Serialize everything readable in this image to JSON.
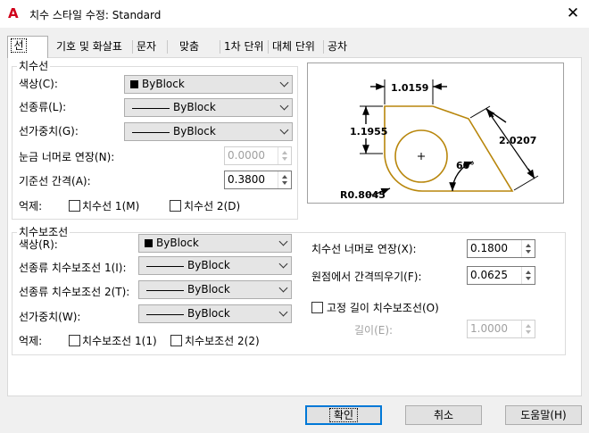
{
  "window": {
    "title": "치수 스타일 수정: Standard",
    "icon": "autocad-a-icon",
    "close_glyph": "✕"
  },
  "tabs": [
    {
      "label": "선",
      "active": true
    },
    {
      "label": "기호 및 화살표"
    },
    {
      "label": "문자"
    },
    {
      "label": "맞춤"
    },
    {
      "label": "1차 단위"
    },
    {
      "label": "대체 단위"
    },
    {
      "label": "공차"
    }
  ],
  "dimension_lines": {
    "group_label": "치수선",
    "color_label": "색상(C):",
    "color_value": "ByBlock",
    "linetype_label": "선종류(L):",
    "linetype_value": "ByBlock",
    "lineweight_label": "선가중치(G):",
    "lineweight_value": "ByBlock",
    "extend_ticks_label": "눈금 너머로 연장(N):",
    "extend_ticks_value": "0.0000",
    "baseline_spacing_label": "기준선 간격(A):",
    "baseline_spacing_value": "0.3800",
    "suppress_label": "억제:",
    "suppress_1": "치수선 1(M)",
    "suppress_2": "치수선 2(D)"
  },
  "extension_lines": {
    "group_label": "치수보조선",
    "color_label": "색상(R):",
    "color_value": "ByBlock",
    "linetype1_label": "선종류 치수보조선 1(I):",
    "linetype1_value": "ByBlock",
    "linetype2_label": "선종류 치수보조선 2(T):",
    "linetype2_value": "ByBlock",
    "lineweight_label": "선가중치(W):",
    "lineweight_value": "ByBlock",
    "suppress_label": "억제:",
    "suppress_1": "치수보조선 1(1)",
    "suppress_2": "치수보조선 2(2)",
    "extend_beyond_label": "치수선 너머로 연장(X):",
    "extend_beyond_value": "0.1800",
    "offset_label": "원점에서 간격띄우기(F):",
    "offset_value": "0.0625",
    "fixed_length_label": "고정 길이 치수보조선(O)",
    "length_label": "길이(E):",
    "length_value": "1.0000"
  },
  "preview": {
    "dim_top": "1.0159",
    "dim_left": "1.1955",
    "dim_right": "2.0207",
    "dim_angle": "60°",
    "dim_radius": "R0.8045",
    "accent": "#b8860b"
  },
  "buttons": {
    "ok": "확인",
    "cancel": "취소",
    "help": "도움말(H)"
  }
}
